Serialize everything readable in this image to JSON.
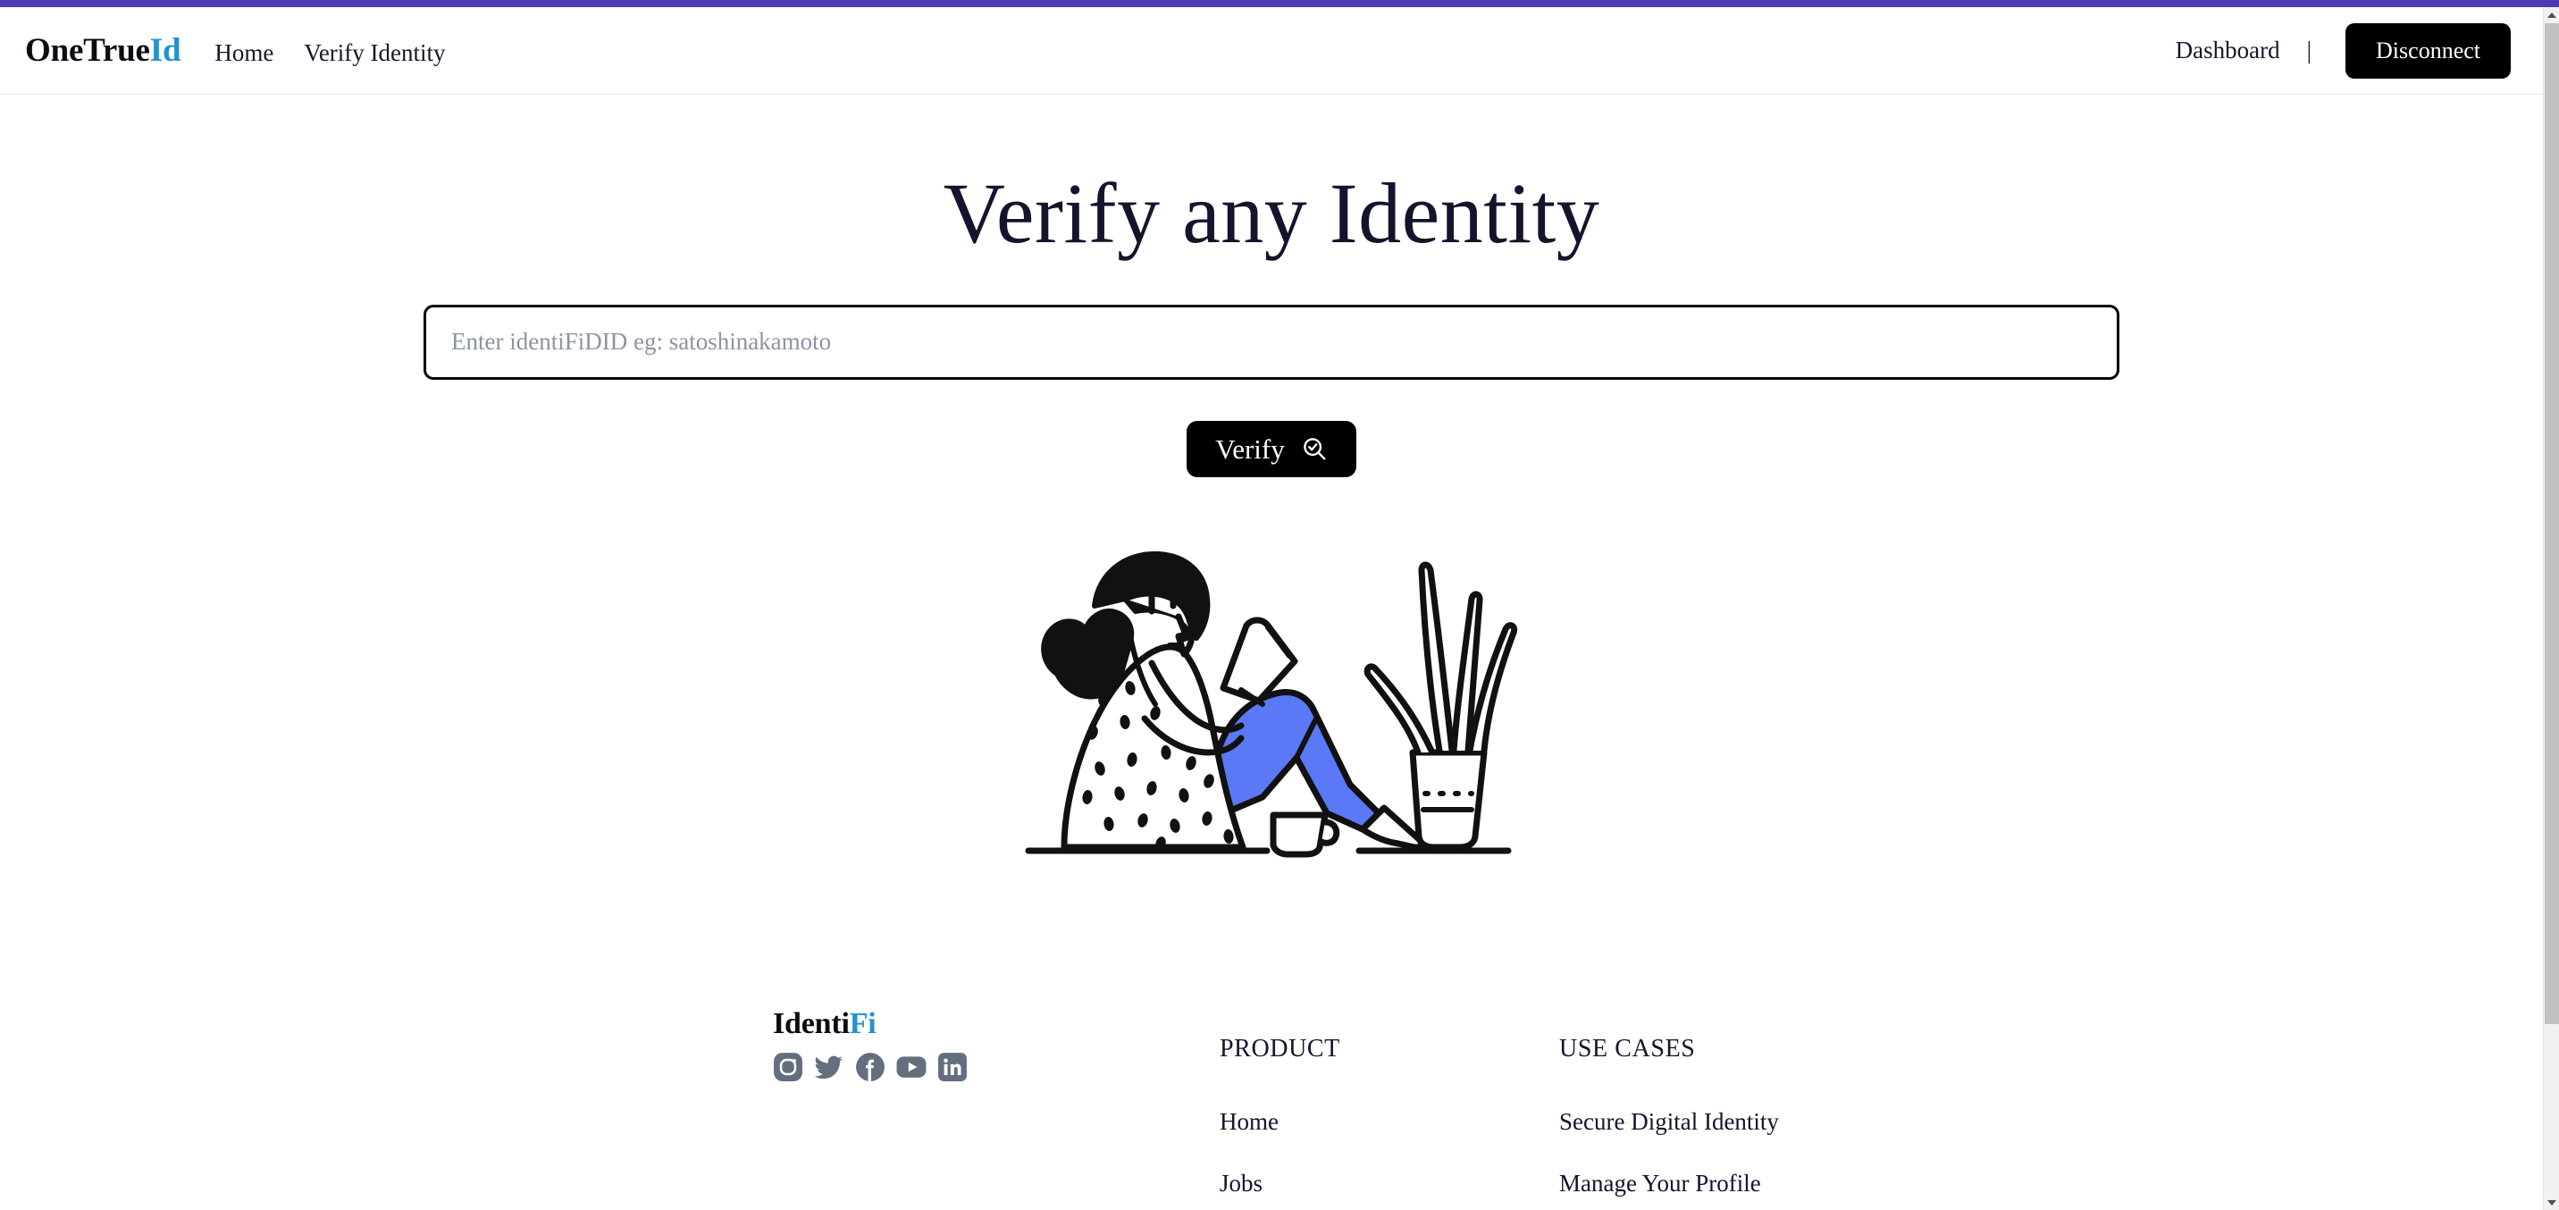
{
  "theme": {
    "accent_bar_color": "#4b3bb5",
    "brand_accent_color": "#2491d1",
    "button_bg_color": "#000000",
    "illustration_accent_color": "#5b78f6",
    "social_icon_color": "#646e7e",
    "text_color": "#12152c",
    "placeholder_color": "#8d93a6"
  },
  "header": {
    "logo": {
      "primary": "OneTrue",
      "accent": "Id"
    },
    "nav": [
      {
        "label": "Home",
        "name": "nav-link-home"
      },
      {
        "label": "Verify Identity",
        "name": "nav-link-verify-identity"
      }
    ],
    "dashboard_label": "Dashboard",
    "divider": "|",
    "disconnect_label": "Disconnect"
  },
  "hero": {
    "title": "Verify any Identity",
    "search": {
      "placeholder": "Enter identiFiDID eg: satoshinakamoto",
      "value": ""
    },
    "verify_button": {
      "label": "Verify",
      "icon": "search-check-icon"
    },
    "illustration": {
      "name": "woman-reading-illustration",
      "alt": "Woman sitting on the floor reading a tablet next to a coffee cup and a potted plant"
    }
  },
  "footer": {
    "logo": {
      "primary": "Identi",
      "accent": "Fi"
    },
    "social": [
      {
        "name": "instagram-icon",
        "label": "Instagram"
      },
      {
        "name": "twitter-icon",
        "label": "Twitter"
      },
      {
        "name": "facebook-icon",
        "label": "Facebook"
      },
      {
        "name": "youtube-icon",
        "label": "YouTube"
      },
      {
        "name": "linkedin-icon",
        "label": "LinkedIn"
      }
    ],
    "columns": [
      {
        "heading": "PRODUCT",
        "links": [
          {
            "label": "Home"
          },
          {
            "label": "Jobs"
          }
        ]
      },
      {
        "heading": "USE CASES",
        "links": [
          {
            "label": "Secure Digital Identity"
          },
          {
            "label": "Manage Your Profile"
          }
        ]
      }
    ]
  },
  "scrollbar": {
    "up_arrow": "scroll-up-arrow-icon",
    "down_arrow": "scroll-down-arrow-icon",
    "thumb": "scroll-thumb"
  }
}
